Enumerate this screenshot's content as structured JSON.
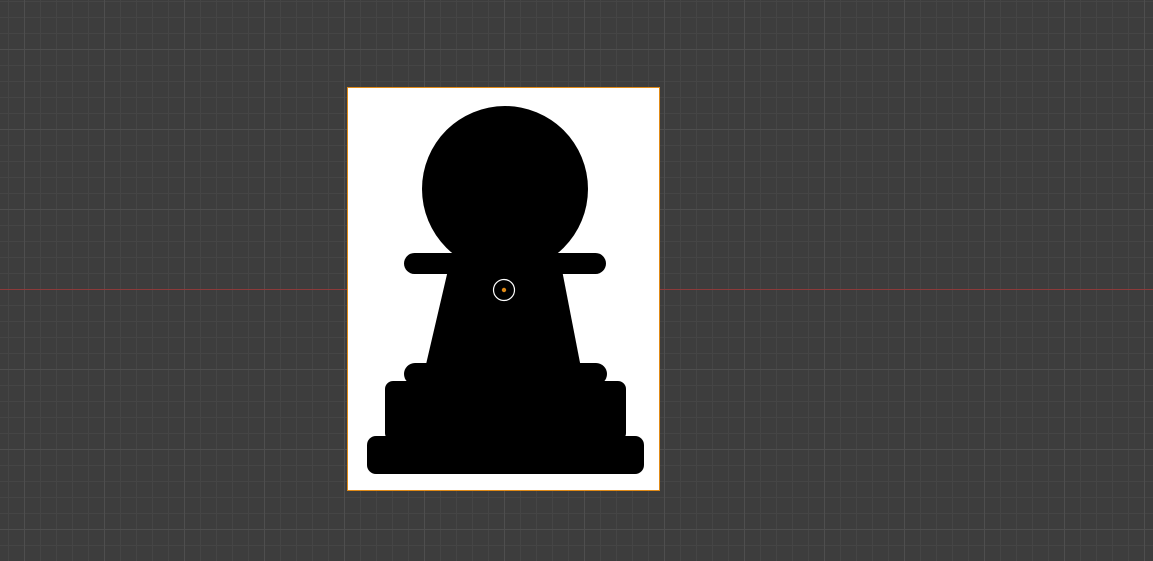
{
  "viewport": {
    "background_color": "#3d3d3d",
    "grid_minor_color": "#454545",
    "grid_major_color": "#4e4e4e",
    "x_axis_color": "#8c3a3a"
  },
  "image_plane": {
    "background_color": "#ffffff",
    "selection_outline_color": "#e08a16",
    "silhouette_color": "#000000",
    "subject": "pawn-silhouette"
  },
  "origin": {
    "icon": "origin-point-icon",
    "ring_color": "#ffffff",
    "dot_color": "#e08a16"
  }
}
